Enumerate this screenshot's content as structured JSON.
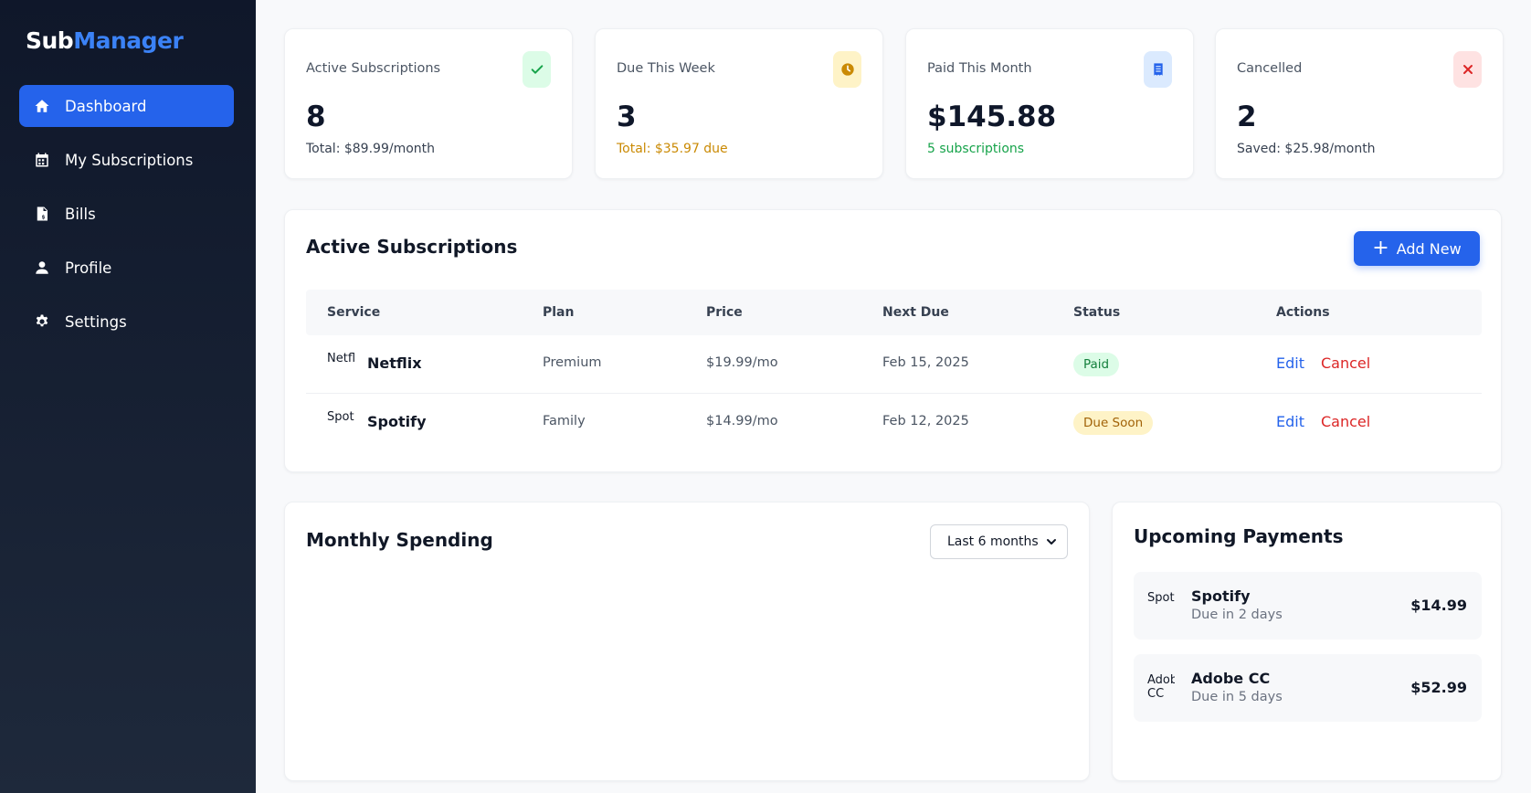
{
  "brand": {
    "part1": "Sub",
    "part2": "Manager"
  },
  "sidebar": {
    "items": [
      {
        "label": "Dashboard",
        "icon": "home-icon",
        "active": true
      },
      {
        "label": "My Subscriptions",
        "icon": "calendar-icon"
      },
      {
        "label": "Bills",
        "icon": "invoice-icon"
      },
      {
        "label": "Profile",
        "icon": "user-icon"
      },
      {
        "label": "Settings",
        "icon": "gear-icon"
      }
    ]
  },
  "stats": [
    {
      "label": "Active Subscriptions",
      "value": "8",
      "sub": "Total: $89.99/month",
      "icon": "check-icon",
      "badge_bg": "#dcfce7",
      "icon_color": "#16a34a",
      "sub_color": "#374151"
    },
    {
      "label": "Due This Week",
      "value": "3",
      "sub": "Total: $35.97 due",
      "icon": "clock-icon",
      "badge_bg": "#fef3c7",
      "icon_color": "#ca8a04",
      "sub_color": "#ca8a04"
    },
    {
      "label": "Paid This Month",
      "value": "$145.88",
      "sub": "5 subscriptions",
      "icon": "receipt-icon",
      "badge_bg": "#dbeafe",
      "icon_color": "#2563eb",
      "sub_color": "#16a34a"
    },
    {
      "label": "Cancelled",
      "value": "2",
      "sub": "Saved: $25.98/month",
      "icon": "close-icon",
      "badge_bg": "#fee2e2",
      "icon_color": "#dc2626",
      "sub_color": "#374151"
    }
  ],
  "subscriptions": {
    "title": "Active Subscriptions",
    "add_label": "Add New",
    "columns": [
      "Service",
      "Plan",
      "Price",
      "Next Due",
      "Status",
      "Actions"
    ],
    "rows": [
      {
        "logo_alt": "Netflix",
        "service": "Netflix",
        "plan": "Premium",
        "price": "$19.99/mo",
        "next_due": "Feb 15, 2025",
        "status": "Paid",
        "edit": "Edit",
        "cancel": "Cancel"
      },
      {
        "logo_alt": "Spotify",
        "service": "Spotify",
        "plan": "Family",
        "price": "$14.99/mo",
        "next_due": "Feb 12, 2025",
        "status": "Due Soon",
        "edit": "Edit",
        "cancel": "Cancel"
      }
    ]
  },
  "spending": {
    "title": "Monthly Spending",
    "range_selected": "Last 6 months"
  },
  "upcoming": {
    "title": "Upcoming Payments",
    "items": [
      {
        "logo_alt": "Spotify",
        "name": "Spotify",
        "due": "Due in 2 days",
        "amount": "$14.99"
      },
      {
        "logo_alt": "Adobe CC",
        "name": "Adobe CC",
        "due": "Due in 5 days",
        "amount": "$52.99"
      }
    ]
  },
  "colors": {
    "accent": "#2563eb",
    "sidebar_top": "#0f172a",
    "sidebar_bottom": "#1e293b"
  }
}
